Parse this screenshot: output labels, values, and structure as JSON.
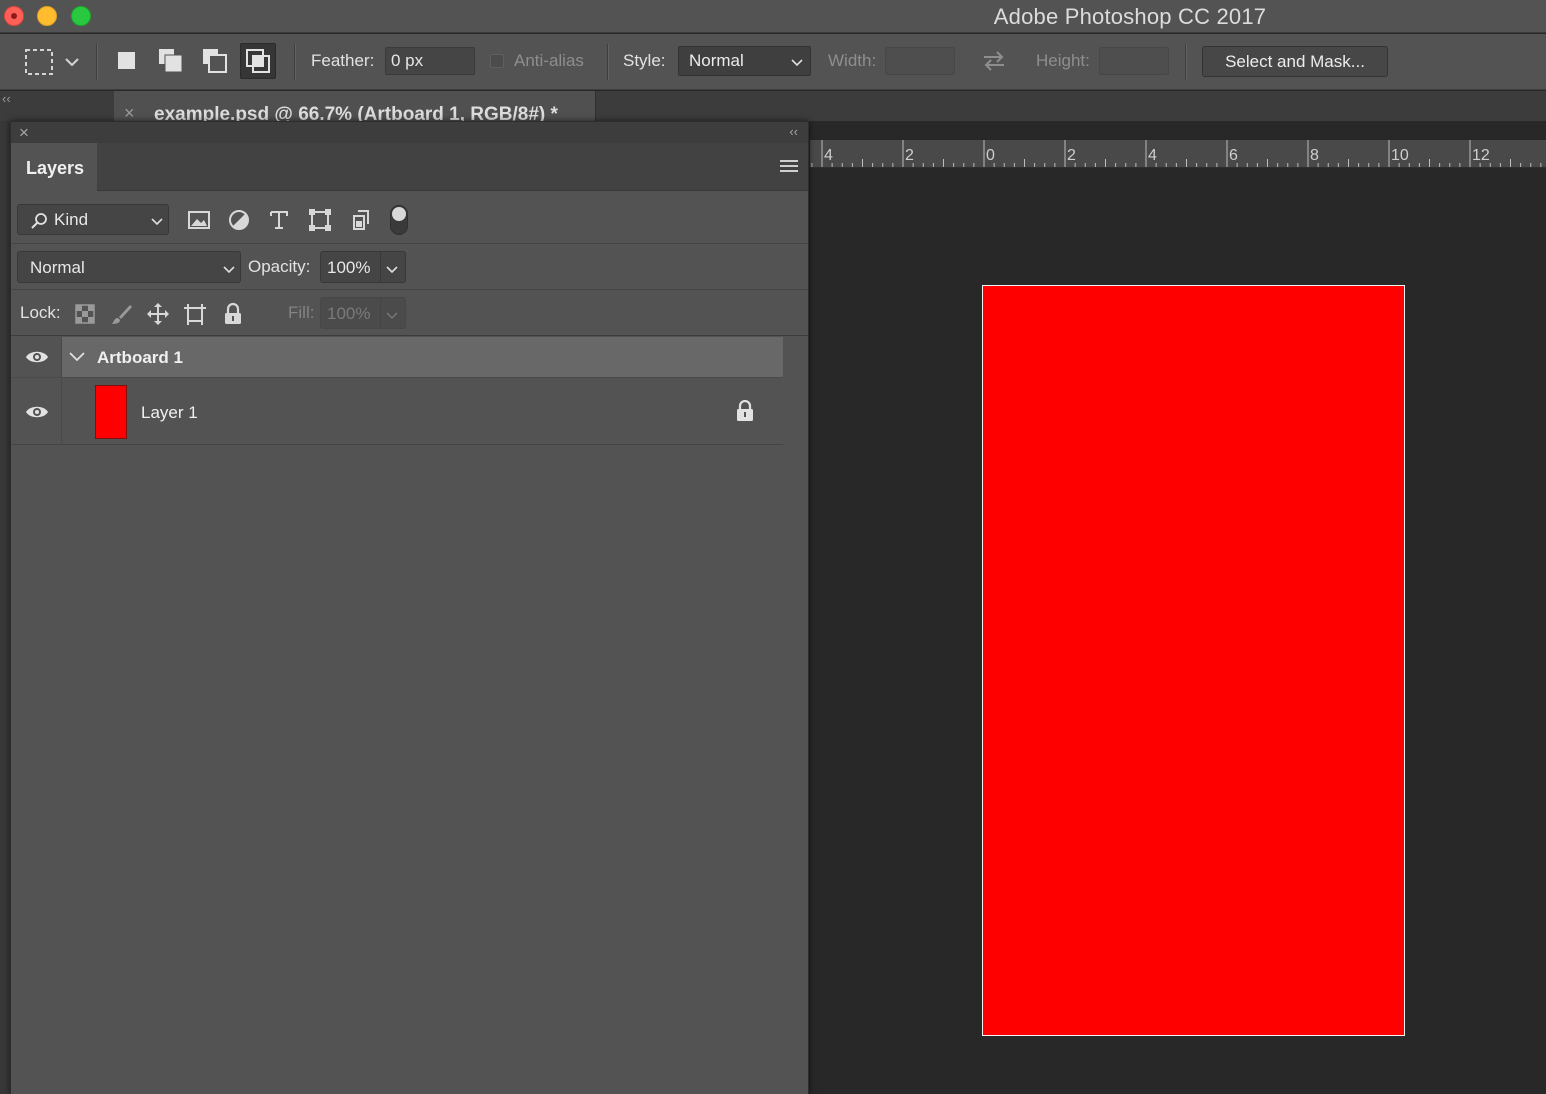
{
  "window": {
    "title": "Adobe Photoshop CC 2017"
  },
  "options_bar": {
    "feather_label": "Feather:",
    "feather_value": "0 px",
    "anti_alias_label": "Anti-alias",
    "style_label": "Style:",
    "style_value": "Normal",
    "width_label": "Width:",
    "width_value": "",
    "height_label": "Height:",
    "height_value": "",
    "select_mask_label": "Select and Mask..."
  },
  "document_tab": {
    "name": "example.psd @ 66.7% (Artboard 1, RGB/8#) *",
    "close_glyph": "×"
  },
  "ruler": {
    "units": "inches",
    "labels": [
      "4",
      "2",
      "0",
      "2",
      "4",
      "6",
      "8",
      "10",
      "12"
    ]
  },
  "layers_panel": {
    "tab_label": "Layers",
    "close_glyph": "×",
    "collapse_glyph": "‹‹",
    "filter": {
      "kind_label": "Kind"
    },
    "blend_mode": "Normal",
    "opacity_label": "Opacity:",
    "opacity_value": "100%",
    "lock_label": "Lock:",
    "fill_label": "Fill:",
    "fill_value": "100%",
    "layers": [
      {
        "name": "Artboard 1",
        "type": "artboard",
        "visible": true,
        "expanded": true
      },
      {
        "name": "Layer 1",
        "type": "pixel",
        "visible": true,
        "locked": true,
        "thumb_color": "#ff0000"
      }
    ]
  },
  "canvas": {
    "artboard_fill": "#ff0000"
  },
  "colors": {
    "chrome": "#535353",
    "workspace": "#282828",
    "selected_row": "#686868"
  }
}
